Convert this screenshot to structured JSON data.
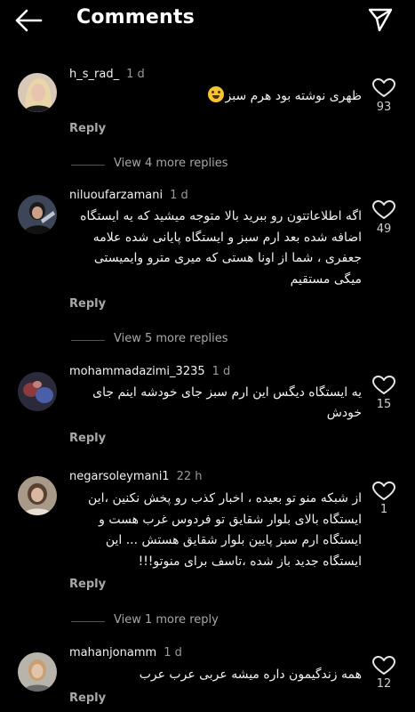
{
  "header": {
    "title": "Comments"
  },
  "comments": [
    {
      "username": "h_s_rad_",
      "time": "1 d",
      "text": "ظهری نوشته بود هرم سبز",
      "likes": "93",
      "reply_label": "Reply",
      "view_more": "View 4 more replies"
    },
    {
      "username": "niluoufarzamani",
      "time": "1 d",
      "text": "اگه اطلاعاتتون رو ببرید بالا متوجه میشید که یه ایستگاه اضافه شده بعد ارم سبز و ایستگاه پایانی شده علامه جعفری ، شما از اونا هستی که میری مترو وایمیستی میگی مستقیم",
      "likes": "49",
      "reply_label": "Reply",
      "view_more": "View 5 more replies"
    },
    {
      "username": "mohammadazimi_3235",
      "time": "1 d",
      "text": "یه ایستگاه دیگس این ارم سبز جای خودشه اینم جای خودش",
      "likes": "15",
      "reply_label": "Reply"
    },
    {
      "username": "negarsoleymani1",
      "time": "22 h",
      "text": "از شبکه منو تو بعیده ، اخبار کذب رو پخش نکنین ،این ایستگاه بالای بلوار شقایق تو فردوس غرب هست و ایستگاه ارم سبز پایین بلوار شقایق هستش ... این ایستگاه جدید باز شده ،تاسف برای منوتو!!!",
      "likes": "1",
      "reply_label": "Reply",
      "view_more": "View 1 more reply"
    },
    {
      "username": "mahanjonamm",
      "time": "1 d",
      "text": "همه زندگیمون داره میشه عربی عرب عرب",
      "likes": "12",
      "reply_label": "Reply"
    }
  ]
}
